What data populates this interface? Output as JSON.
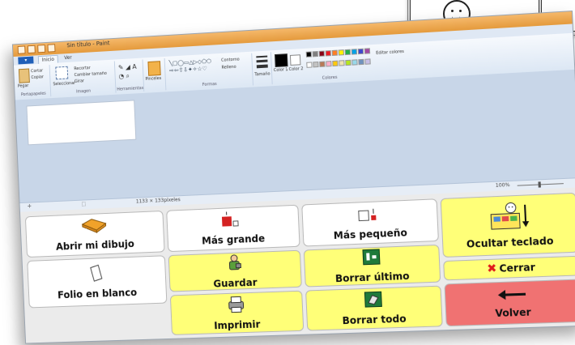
{
  "window": {
    "title": "Sin título - Paint",
    "tabs": [
      "Inicio",
      "Ver"
    ]
  },
  "ribbon": {
    "groups": [
      "Portapapeles",
      "Imagen",
      "Herramientas",
      "Formas",
      "Colores"
    ],
    "paste_label": "Pegar",
    "cut_label": "Cortar",
    "copy_label": "Copiar",
    "select_label": "Seleccionar",
    "crop_label": "Recortar",
    "resize_label": "Cambiar tamaño",
    "rotate_label": "Girar",
    "brushes_label": "Pinceles",
    "outline_label": "Contorno",
    "fill_label": "Relleno",
    "size_label": "Tamaño",
    "color1_label": "Color 1",
    "color2_label": "Color 2",
    "edit_colors_label": "Editar colores",
    "palette": [
      "#000000",
      "#7f7f7f",
      "#880015",
      "#ed1c24",
      "#ff7f27",
      "#fff200",
      "#22b14c",
      "#00a2e8",
      "#3f48cc",
      "#a349a4",
      "#ffffff",
      "#c3c3c3",
      "#b97a57",
      "#ffaec9",
      "#ffc90e",
      "#efe4b0",
      "#b5e61d",
      "#99d9ea",
      "#7092be",
      "#c8bfe7"
    ]
  },
  "statusbar": {
    "size": "1133 × 133píxeles",
    "zoom": "100%"
  },
  "keyboard": {
    "open_drawing": "Abrir mi dibujo",
    "blank_sheet": "Folio en blanco",
    "bigger": "Más grande",
    "save": "Guardar",
    "print": "Imprimir",
    "smaller": "Más pequeño",
    "undo_last": "Borrar último",
    "clear_all": "Borrar todo",
    "hide_keyboard": "Ocultar teclado",
    "close": "Cerrar",
    "back": "Volver"
  },
  "colors": {
    "key_white": "#ffffff",
    "key_yellow": "#ffff78",
    "key_red": "#f07272",
    "title_orange": "#e49a3c"
  }
}
